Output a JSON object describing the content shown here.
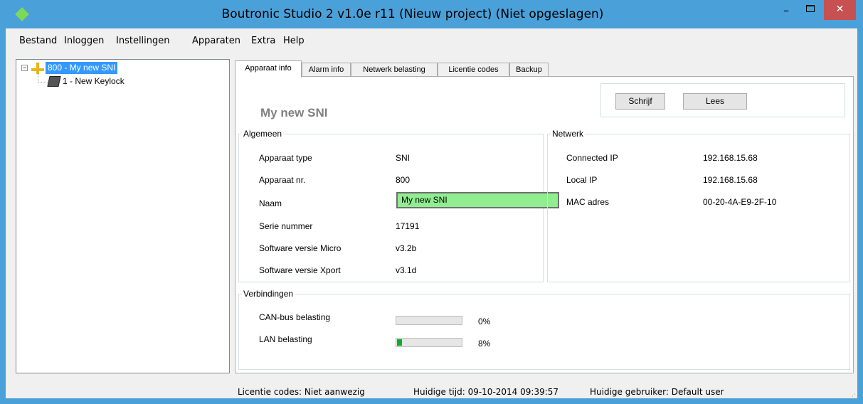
{
  "window": {
    "title": "Boutronic Studio 2 v1.0e r11 (Nieuw project) (Niet opgeslagen)",
    "min_glyph": "–",
    "close_glyph": "✕"
  },
  "menu": {
    "items": [
      "Bestand",
      "Inloggen",
      "Instellingen",
      "Apparaten",
      "Extra",
      "Help"
    ]
  },
  "tree": {
    "root_label": "800 - My new SNI",
    "child_label": "1 - New Keylock",
    "expander": "−"
  },
  "tabs": [
    "Apparaat info",
    "Alarm info",
    "Netwerk belasting",
    "Licentie codes",
    "Backup"
  ],
  "actions": {
    "write_label": "Schrijf",
    "read_label": "Lees"
  },
  "device_name": "My new SNI",
  "general": {
    "title": "Algemeen",
    "rows": [
      {
        "label": "Apparaat type",
        "value": "SNI"
      },
      {
        "label": "Apparaat nr.",
        "value": "800"
      },
      {
        "label": "Naam",
        "value": "My new SNI"
      },
      {
        "label": "Serie nummer",
        "value": "17191"
      },
      {
        "label": "Software versie Micro",
        "value": "v3.2b"
      },
      {
        "label": "Software versie Xport",
        "value": "v3.1d"
      }
    ]
  },
  "network": {
    "title": "Netwerk",
    "rows": [
      {
        "label": "Connected IP",
        "value": "192.168.15.68"
      },
      {
        "label": "Local IP",
        "value": "192.168.15.68"
      },
      {
        "label": "MAC adres",
        "value": "00-20-4A-E9-2F-10"
      }
    ]
  },
  "connections": {
    "title": "Verbindingen",
    "rows": [
      {
        "label": "CAN-bus belasting",
        "percent": 0,
        "text": "0%"
      },
      {
        "label": "LAN belasting",
        "percent": 8,
        "text": "8%"
      }
    ]
  },
  "status": {
    "license": "Licentie codes: Niet aanwezig",
    "time": "Huidige tijd: 09-10-2014 09:39:57",
    "user": "Huidige gebruiker: Default user"
  },
  "colors": {
    "titlebar": "#4aa0d8",
    "close_button": "#c75050",
    "selection": "#3399ff",
    "name_field": "#90ee90",
    "progress": "#06b025"
  }
}
